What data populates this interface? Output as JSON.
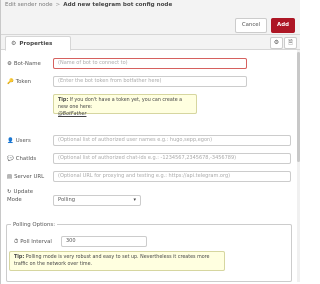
{
  "header": {
    "breadcrumb_prev": "Edit sender node",
    "breadcrumb_sep": ">",
    "breadcrumb_current": "Add new telegram bot config node",
    "cancel_label": "Cancel",
    "add_label": "Add"
  },
  "tabs": {
    "properties_label": "Properties",
    "gear_icon": "⚙",
    "settings_icon": "⚙",
    "doc_icon": "🗎"
  },
  "form": {
    "botname": {
      "icon": "⚙",
      "label": "Bot-Name",
      "placeholder": "(Name of bot to connect to)"
    },
    "token": {
      "icon": "🔑",
      "label": "Token",
      "placeholder": "(Enter the bot token from botfather here)"
    },
    "tip1": {
      "prefix": "Tip:",
      "text": " If you don't have a token yet, you can create a new one here:",
      "link": "@BotFather"
    },
    "users": {
      "icon": "👤",
      "label": "Users",
      "placeholder": "(Optional list of authorized user names e.g.: hugo,sepp,egon)"
    },
    "chatids": {
      "icon": "💬",
      "label": "ChatIds",
      "placeholder": "(Optional list of authorized chat-ids e.g.: -1234567,2345678,-3456789)"
    },
    "server_url": {
      "icon": "▤",
      "label": "Server URL",
      "placeholder": "(Optional URL for proxying and testing e.g.: https://api.telegram.org)"
    },
    "update_mode": {
      "icon": "↻",
      "label_line1": "Update",
      "label_line2": "Mode",
      "value": "Polling",
      "caret": "▾"
    },
    "polling": {
      "legend": "Polling Options:",
      "poll_interval_icon": "⏱",
      "poll_interval_label": "Poll Interval",
      "poll_interval_value": "300",
      "tip_prefix": "Tip:",
      "tip_text": " Polling mode is very robust and easy to set up. Nevertheless it creates more traffic on the network over time."
    }
  }
}
